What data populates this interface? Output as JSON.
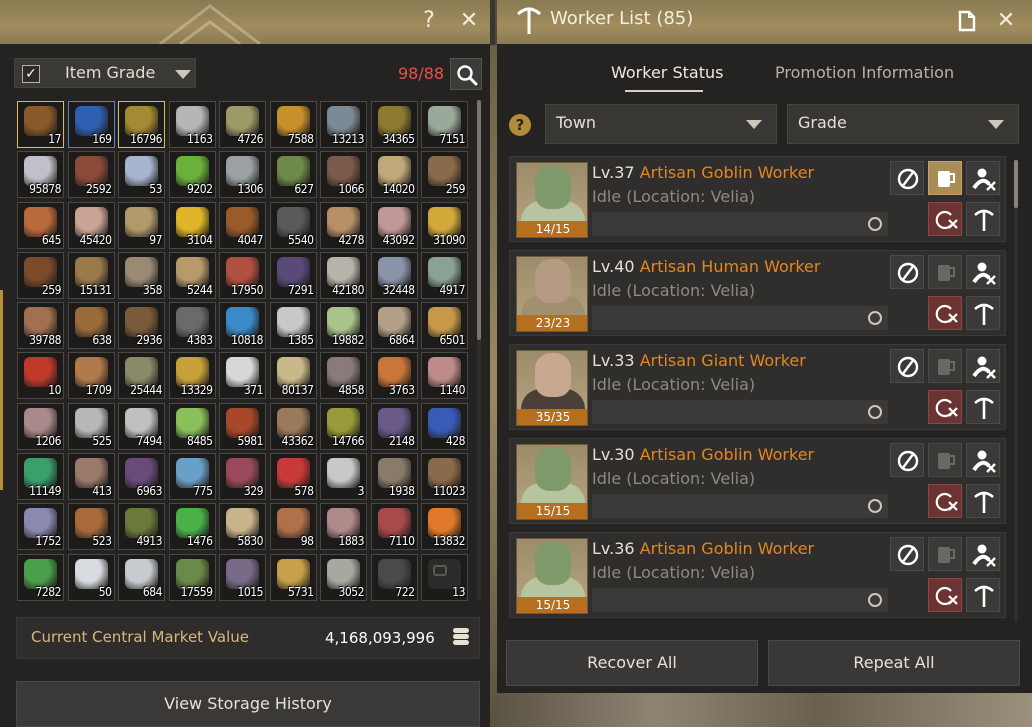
{
  "storage": {
    "help": "?",
    "close": "✕",
    "filter": {
      "checkbox": "✓",
      "label": "Item Grade"
    },
    "capacity": "98/88",
    "items": [
      {
        "q": "17",
        "c": "#8a5a2a",
        "sel": true
      },
      {
        "q": "169",
        "c": "#2f5fb0",
        "blue": true
      },
      {
        "q": "16796",
        "c": "#a48a32",
        "sel": true
      },
      {
        "q": "1163",
        "c": "#b6b6b6"
      },
      {
        "q": "4726",
        "c": "#9d9a68"
      },
      {
        "q": "7588",
        "c": "#c8902c"
      },
      {
        "q": "13213",
        "c": "#7c8a96"
      },
      {
        "q": "34365",
        "c": "#8c7a30"
      },
      {
        "q": "7151",
        "c": "#9aaa9a"
      },
      {
        "q": "95878",
        "c": "#c0c0c8"
      },
      {
        "q": "2592",
        "c": "#8a4a3a"
      },
      {
        "q": "53",
        "c": "#a8b4d0"
      },
      {
        "q": "9202",
        "c": "#6ab03a"
      },
      {
        "q": "1306",
        "c": "#9aa0a4"
      },
      {
        "q": "627",
        "c": "#6e8a4a"
      },
      {
        "q": "1066",
        "c": "#7a5a4a"
      },
      {
        "q": "14020",
        "c": "#c0a878"
      },
      {
        "q": "259",
        "c": "#8a6a4a"
      },
      {
        "q": "645",
        "c": "#b86a3a"
      },
      {
        "q": "45420",
        "c": "#c8a494"
      },
      {
        "q": "97",
        "c": "#b09a6a"
      },
      {
        "q": "3104",
        "c": "#e0b428"
      },
      {
        "q": "4047",
        "c": "#9a5a2a"
      },
      {
        "q": "5540",
        "c": "#5a5a5a"
      },
      {
        "q": "4278",
        "c": "#b89068"
      },
      {
        "q": "43092",
        "c": "#c09898"
      },
      {
        "q": "31090",
        "c": "#d2a83a"
      },
      {
        "q": "259",
        "c": "#7a4a2a"
      },
      {
        "q": "15131",
        "c": "#9a7a4a"
      },
      {
        "q": "358",
        "c": "#9a8a74"
      },
      {
        "q": "5244",
        "c": "#b89a6a"
      },
      {
        "q": "17950",
        "c": "#b05040"
      },
      {
        "q": "7291",
        "c": "#5a4a7a"
      },
      {
        "q": "42180",
        "c": "#b8b4aa"
      },
      {
        "q": "32448",
        "c": "#8a94a8"
      },
      {
        "q": "4917",
        "c": "#8aa294"
      },
      {
        "q": "39788",
        "c": "#a07050"
      },
      {
        "q": "638",
        "c": "#9a6a3a"
      },
      {
        "q": "2936",
        "c": "#7a5a3a"
      },
      {
        "q": "4383",
        "c": "#6a6a6a"
      },
      {
        "q": "10818",
        "c": "#3a8ac8"
      },
      {
        "q": "1385",
        "c": "#c8c8c8"
      },
      {
        "q": "19882",
        "c": "#a8c48a"
      },
      {
        "q": "6864",
        "c": "#b4a08a"
      },
      {
        "q": "6501",
        "c": "#c89848"
      },
      {
        "q": "10",
        "c": "#c03a2a"
      },
      {
        "q": "1709",
        "c": "#b07a4a"
      },
      {
        "q": "25444",
        "c": "#8a8a6a"
      },
      {
        "q": "13329",
        "c": "#c8a03a"
      },
      {
        "q": "371",
        "c": "#d8d8d8"
      },
      {
        "q": "80137",
        "c": "#c8b88a"
      },
      {
        "q": "4858",
        "c": "#8a7a7a"
      },
      {
        "q": "3763",
        "c": "#c8763a"
      },
      {
        "q": "1140",
        "c": "#c08a8a"
      },
      {
        "q": "1206",
        "c": "#a88a8a"
      },
      {
        "q": "525",
        "c": "#b8b8b8"
      },
      {
        "q": "7494",
        "c": "#c0c0c0"
      },
      {
        "q": "8485",
        "c": "#8ac05a"
      },
      {
        "q": "5981",
        "c": "#a8482a"
      },
      {
        "q": "43362",
        "c": "#9a7a5a"
      },
      {
        "q": "14766",
        "c": "#9a9a3a"
      },
      {
        "q": "2148",
        "c": "#6a5a8a"
      },
      {
        "q": "428",
        "c": "#3a5ab8"
      },
      {
        "q": "11149",
        "c": "#3aa06a"
      },
      {
        "q": "413",
        "c": "#9a7a6a"
      },
      {
        "q": "6963",
        "c": "#6a4a7a"
      },
      {
        "q": "775",
        "c": "#6aa0c8"
      },
      {
        "q": "329",
        "c": "#9a4a5a"
      },
      {
        "q": "578",
        "c": "#c83a3a"
      },
      {
        "q": "3",
        "c": "#c8c8c8"
      },
      {
        "q": "1938",
        "c": "#8a7a6a"
      },
      {
        "q": "11023",
        "c": "#8a6a4a"
      },
      {
        "q": "1752",
        "c": "#8a8ab0"
      },
      {
        "q": "523",
        "c": "#a86a3a"
      },
      {
        "q": "4913",
        "c": "#6a7a3a"
      },
      {
        "q": "1476",
        "c": "#4ab04a"
      },
      {
        "q": "5830",
        "c": "#c8b48a"
      },
      {
        "q": "98",
        "c": "#b0704a"
      },
      {
        "q": "1883",
        "c": "#b08a8a"
      },
      {
        "q": "7110",
        "c": "#a84a4a"
      },
      {
        "q": "13832",
        "c": "#e07a2a"
      },
      {
        "q": "7282",
        "c": "#4aa04a"
      },
      {
        "q": "50",
        "c": "#d8dce0"
      },
      {
        "q": "684",
        "c": "#c8ccd0"
      },
      {
        "q": "17559",
        "c": "#6a8a4a"
      },
      {
        "q": "1015",
        "c": "#7a6a8a"
      },
      {
        "q": "5731",
        "c": "#c8a04a"
      },
      {
        "q": "3052",
        "c": "#a8a8a0"
      },
      {
        "q": "722",
        "c": "#4a4a48"
      },
      {
        "q": "13",
        "c": "#2c2b29",
        "locked": true
      }
    ],
    "market_label": "Current Central Market Value",
    "market_value": "4,168,093,996",
    "history_button": "View Storage History"
  },
  "workers": {
    "title": "Worker List (85)",
    "tabs": [
      "Worker Status",
      "Promotion Information"
    ],
    "help": "?",
    "filters": {
      "town": "Town",
      "grade": "Grade"
    },
    "list": [
      {
        "level": "Lv.37",
        "name": "Artisan Goblin Worker",
        "status": "Idle (Location: Velia)",
        "stamina": "14/15",
        "race": "goblin",
        "active_beer": true
      },
      {
        "level": "Lv.40",
        "name": "Artisan Human Worker",
        "status": "Idle (Location: Velia)",
        "stamina": "23/23",
        "race": "human",
        "active_beer": false
      },
      {
        "level": "Lv.33",
        "name": "Artisan Giant Worker",
        "status": "Idle (Location: Velia)",
        "stamina": "35/35",
        "race": "giant",
        "active_beer": false
      },
      {
        "level": "Lv.30",
        "name": "Artisan Goblin Worker",
        "status": "Idle (Location: Velia)",
        "stamina": "15/15",
        "race": "goblin",
        "active_beer": false
      },
      {
        "level": "Lv.36",
        "name": "Artisan Goblin Worker",
        "status": "Idle (Location: Velia)",
        "stamina": "15/15",
        "race": "goblin",
        "active_beer": false
      }
    ],
    "recover_all": "Recover All",
    "repeat_all": "Repeat All"
  }
}
